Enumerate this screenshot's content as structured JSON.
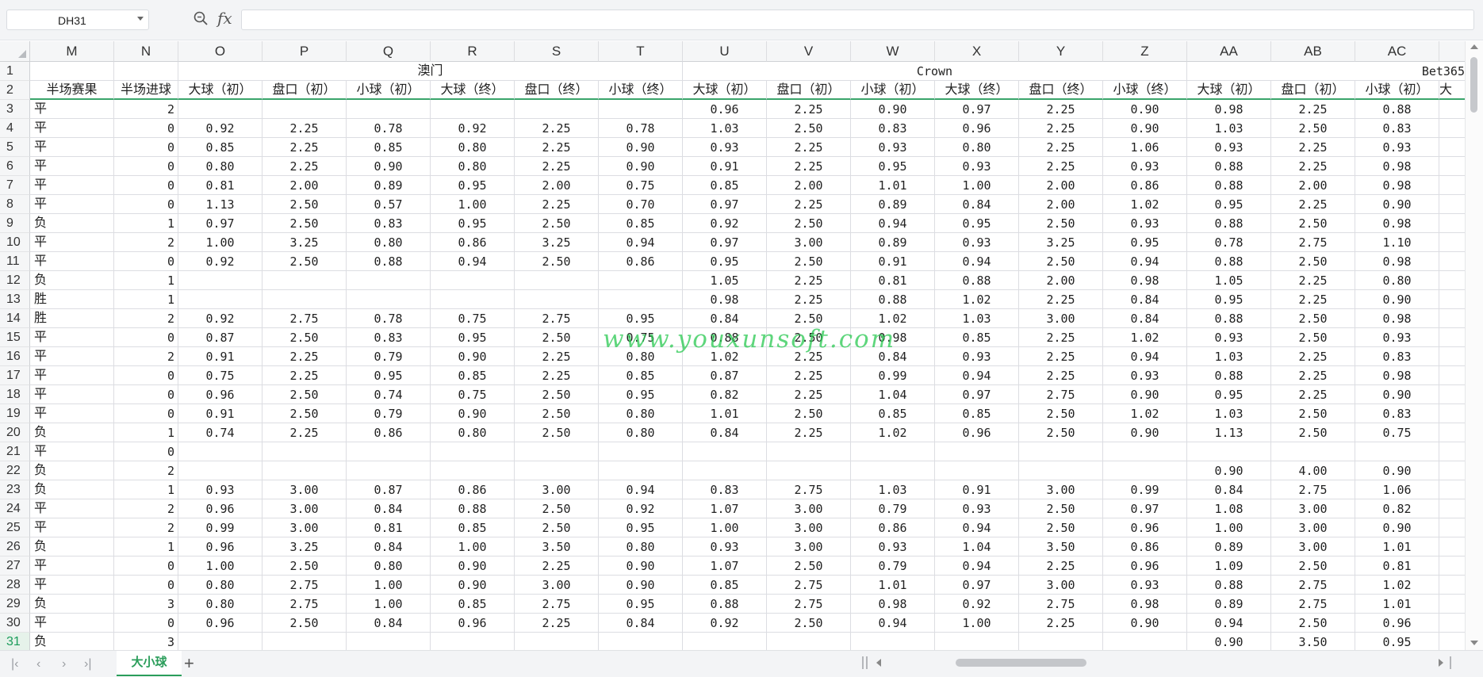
{
  "namebox": "DH31",
  "formula": "",
  "fx_label": "fx",
  "columns": [
    "M",
    "N",
    "O",
    "P",
    "Q",
    "R",
    "S",
    "T",
    "U",
    "V",
    "W",
    "X",
    "Y",
    "Z",
    "AA",
    "AB",
    "AC"
  ],
  "row1_groups": {
    "aomen": "澳门",
    "crown": "Crown",
    "bet365": "Bet365"
  },
  "row2_headers": [
    "半场赛果",
    "半场进球",
    "大球（初）",
    "盘口（初）",
    "小球（初）",
    "大球（终）",
    "盘口（终）",
    "小球（终）",
    "大球（初）",
    "盘口（初）",
    "小球（初）",
    "大球（终）",
    "盘口（终）",
    "小球（终）",
    "大球（初）",
    "盘口（初）",
    "小球（初）",
    "大"
  ],
  "rows": [
    {
      "n": 3,
      "cells": [
        "平",
        "2",
        "",
        "",
        "",
        "",
        "",
        "",
        "0.96",
        "2.25",
        "0.90",
        "0.97",
        "2.25",
        "0.90",
        "0.98",
        "2.25",
        "0.88"
      ]
    },
    {
      "n": 4,
      "cells": [
        "平",
        "0",
        "0.92",
        "2.25",
        "0.78",
        "0.92",
        "2.25",
        "0.78",
        "1.03",
        "2.50",
        "0.83",
        "0.96",
        "2.25",
        "0.90",
        "1.03",
        "2.50",
        "0.83"
      ]
    },
    {
      "n": 5,
      "cells": [
        "平",
        "0",
        "0.85",
        "2.25",
        "0.85",
        "0.80",
        "2.25",
        "0.90",
        "0.93",
        "2.25",
        "0.93",
        "0.80",
        "2.25",
        "1.06",
        "0.93",
        "2.25",
        "0.93"
      ]
    },
    {
      "n": 6,
      "cells": [
        "平",
        "0",
        "0.80",
        "2.25",
        "0.90",
        "0.80",
        "2.25",
        "0.90",
        "0.91",
        "2.25",
        "0.95",
        "0.93",
        "2.25",
        "0.93",
        "0.88",
        "2.25",
        "0.98"
      ]
    },
    {
      "n": 7,
      "cells": [
        "平",
        "0",
        "0.81",
        "2.00",
        "0.89",
        "0.95",
        "2.00",
        "0.75",
        "0.85",
        "2.00",
        "1.01",
        "1.00",
        "2.00",
        "0.86",
        "0.88",
        "2.00",
        "0.98"
      ]
    },
    {
      "n": 8,
      "cells": [
        "平",
        "0",
        "1.13",
        "2.50",
        "0.57",
        "1.00",
        "2.25",
        "0.70",
        "0.97",
        "2.25",
        "0.89",
        "0.84",
        "2.00",
        "1.02",
        "0.95",
        "2.25",
        "0.90"
      ]
    },
    {
      "n": 9,
      "cells": [
        "负",
        "1",
        "0.97",
        "2.50",
        "0.83",
        "0.95",
        "2.50",
        "0.85",
        "0.92",
        "2.50",
        "0.94",
        "0.95",
        "2.50",
        "0.93",
        "0.88",
        "2.50",
        "0.98"
      ]
    },
    {
      "n": 10,
      "cells": [
        "平",
        "2",
        "1.00",
        "3.25",
        "0.80",
        "0.86",
        "3.25",
        "0.94",
        "0.97",
        "3.00",
        "0.89",
        "0.93",
        "3.25",
        "0.95",
        "0.78",
        "2.75",
        "1.10"
      ]
    },
    {
      "n": 11,
      "cells": [
        "平",
        "0",
        "0.92",
        "2.50",
        "0.88",
        "0.94",
        "2.50",
        "0.86",
        "0.95",
        "2.50",
        "0.91",
        "0.94",
        "2.50",
        "0.94",
        "0.88",
        "2.50",
        "0.98"
      ]
    },
    {
      "n": 12,
      "cells": [
        "负",
        "1",
        "",
        "",
        "",
        "",
        "",
        "",
        "1.05",
        "2.25",
        "0.81",
        "0.88",
        "2.00",
        "0.98",
        "1.05",
        "2.25",
        "0.80"
      ]
    },
    {
      "n": 13,
      "cells": [
        "胜",
        "1",
        "",
        "",
        "",
        "",
        "",
        "",
        "0.98",
        "2.25",
        "0.88",
        "1.02",
        "2.25",
        "0.84",
        "0.95",
        "2.25",
        "0.90"
      ]
    },
    {
      "n": 14,
      "cells": [
        "胜",
        "2",
        "0.92",
        "2.75",
        "0.78",
        "0.75",
        "2.75",
        "0.95",
        "0.84",
        "2.50",
        "1.02",
        "1.03",
        "3.00",
        "0.84",
        "0.88",
        "2.50",
        "0.98"
      ]
    },
    {
      "n": 15,
      "cells": [
        "平",
        "0",
        "0.87",
        "2.50",
        "0.83",
        "0.95",
        "2.50",
        "0.75",
        "0.88",
        "2.50",
        "0.98",
        "0.85",
        "2.25",
        "1.02",
        "0.93",
        "2.50",
        "0.93"
      ]
    },
    {
      "n": 16,
      "cells": [
        "平",
        "2",
        "0.91",
        "2.25",
        "0.79",
        "0.90",
        "2.25",
        "0.80",
        "1.02",
        "2.25",
        "0.84",
        "0.93",
        "2.25",
        "0.94",
        "1.03",
        "2.25",
        "0.83"
      ]
    },
    {
      "n": 17,
      "cells": [
        "平",
        "0",
        "0.75",
        "2.25",
        "0.95",
        "0.85",
        "2.25",
        "0.85",
        "0.87",
        "2.25",
        "0.99",
        "0.94",
        "2.25",
        "0.93",
        "0.88",
        "2.25",
        "0.98"
      ]
    },
    {
      "n": 18,
      "cells": [
        "平",
        "0",
        "0.96",
        "2.50",
        "0.74",
        "0.75",
        "2.50",
        "0.95",
        "0.82",
        "2.25",
        "1.04",
        "0.97",
        "2.75",
        "0.90",
        "0.95",
        "2.25",
        "0.90"
      ]
    },
    {
      "n": 19,
      "cells": [
        "平",
        "0",
        "0.91",
        "2.50",
        "0.79",
        "0.90",
        "2.50",
        "0.80",
        "1.01",
        "2.50",
        "0.85",
        "0.85",
        "2.50",
        "1.02",
        "1.03",
        "2.50",
        "0.83"
      ]
    },
    {
      "n": 20,
      "cells": [
        "负",
        "1",
        "0.74",
        "2.25",
        "0.86",
        "0.80",
        "2.50",
        "0.80",
        "0.84",
        "2.25",
        "1.02",
        "0.96",
        "2.50",
        "0.90",
        "1.13",
        "2.50",
        "0.75"
      ]
    },
    {
      "n": 21,
      "cells": [
        "平",
        "0",
        "",
        "",
        "",
        "",
        "",
        "",
        "",
        "",
        "",
        "",
        "",
        "",
        "",
        "",
        ""
      ]
    },
    {
      "n": 22,
      "cells": [
        "负",
        "2",
        "",
        "",
        "",
        "",
        "",
        "",
        "",
        "",
        "",
        "",
        "",
        "",
        "0.90",
        "4.00",
        "0.90"
      ]
    },
    {
      "n": 23,
      "cells": [
        "负",
        "1",
        "0.93",
        "3.00",
        "0.87",
        "0.86",
        "3.00",
        "0.94",
        "0.83",
        "2.75",
        "1.03",
        "0.91",
        "3.00",
        "0.99",
        "0.84",
        "2.75",
        "1.06"
      ]
    },
    {
      "n": 24,
      "cells": [
        "平",
        "2",
        "0.96",
        "3.00",
        "0.84",
        "0.88",
        "2.50",
        "0.92",
        "1.07",
        "3.00",
        "0.79",
        "0.93",
        "2.50",
        "0.97",
        "1.08",
        "3.00",
        "0.82"
      ]
    },
    {
      "n": 25,
      "cells": [
        "平",
        "2",
        "0.99",
        "3.00",
        "0.81",
        "0.85",
        "2.50",
        "0.95",
        "1.00",
        "3.00",
        "0.86",
        "0.94",
        "2.50",
        "0.96",
        "1.00",
        "3.00",
        "0.90"
      ]
    },
    {
      "n": 26,
      "cells": [
        "负",
        "1",
        "0.96",
        "3.25",
        "0.84",
        "1.00",
        "3.50",
        "0.80",
        "0.93",
        "3.00",
        "0.93",
        "1.04",
        "3.50",
        "0.86",
        "0.89",
        "3.00",
        "1.01"
      ]
    },
    {
      "n": 27,
      "cells": [
        "平",
        "0",
        "1.00",
        "2.50",
        "0.80",
        "0.90",
        "2.25",
        "0.90",
        "1.07",
        "2.50",
        "0.79",
        "0.94",
        "2.25",
        "0.96",
        "1.09",
        "2.50",
        "0.81"
      ]
    },
    {
      "n": 28,
      "cells": [
        "平",
        "0",
        "0.80",
        "2.75",
        "1.00",
        "0.90",
        "3.00",
        "0.90",
        "0.85",
        "2.75",
        "1.01",
        "0.97",
        "3.00",
        "0.93",
        "0.88",
        "2.75",
        "1.02"
      ]
    },
    {
      "n": 29,
      "cells": [
        "负",
        "3",
        "0.80",
        "2.75",
        "1.00",
        "0.85",
        "2.75",
        "0.95",
        "0.88",
        "2.75",
        "0.98",
        "0.92",
        "2.75",
        "0.98",
        "0.89",
        "2.75",
        "1.01"
      ]
    },
    {
      "n": 30,
      "cells": [
        "平",
        "0",
        "0.96",
        "2.50",
        "0.84",
        "0.96",
        "2.25",
        "0.84",
        "0.92",
        "2.50",
        "0.94",
        "1.00",
        "2.25",
        "0.90",
        "0.94",
        "2.50",
        "0.96"
      ]
    },
    {
      "n": 31,
      "cells": [
        "负",
        "3",
        "",
        "",
        "",
        "",
        "",
        "",
        "",
        "",
        "",
        "",
        "",
        "",
        "0.90",
        "3.50",
        "0.95"
      ]
    }
  ],
  "watermark": "www.youxunsoft.com",
  "sheet_tab": "大小球",
  "colors": {
    "accent": "#2a9d5a",
    "header_bg": "#f5f6f7",
    "grid": "#dcdde2"
  }
}
